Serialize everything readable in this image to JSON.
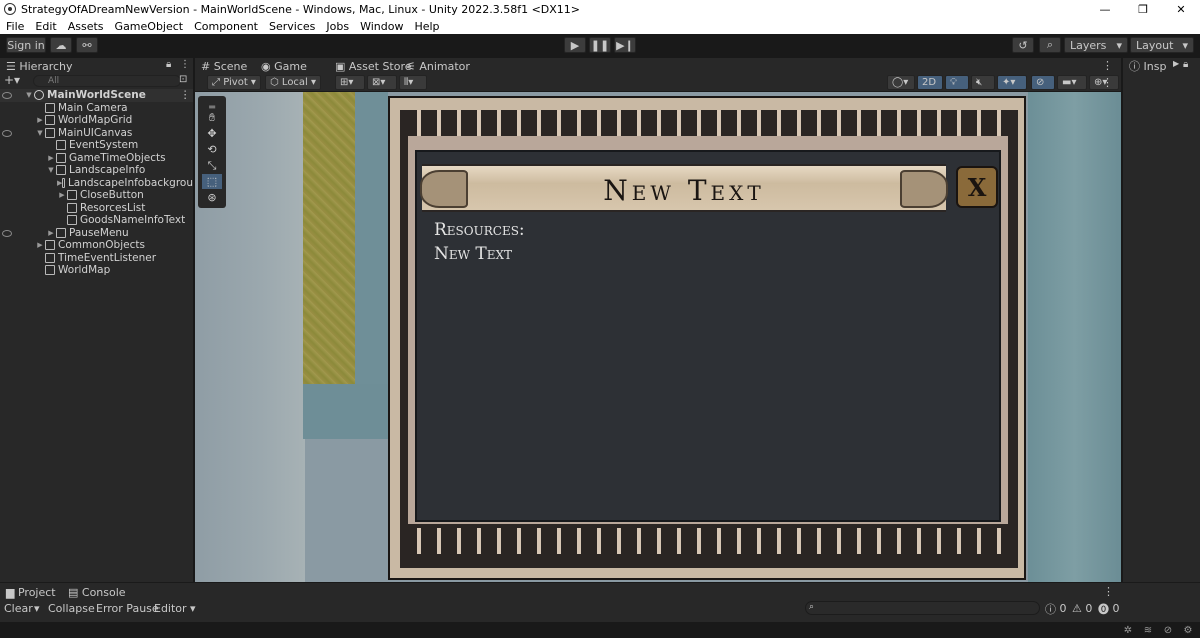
{
  "window": {
    "title": "StrategyOfADreamNewVersion - MainWorldScene - Windows, Mac, Linux - Unity 2022.3.58f1 <DX11>"
  },
  "menu": [
    "File",
    "Edit",
    "Assets",
    "GameObject",
    "Component",
    "Services",
    "Jobs",
    "Window",
    "Help"
  ],
  "toolbar": {
    "sign_in": "Sign in",
    "layers": "Layers",
    "layout": "Layout"
  },
  "hierarchy": {
    "tab": "Hierarchy",
    "search_placeholder": "All",
    "rows": [
      {
        "label": "MainWorldScene",
        "depth": 0,
        "arrow": "▼",
        "scene": true
      },
      {
        "label": "Main Camera",
        "depth": 1,
        "arrow": ""
      },
      {
        "label": "WorldMapGrid",
        "depth": 1,
        "arrow": "▶"
      },
      {
        "label": "MainUICanvas",
        "depth": 1,
        "arrow": "▼"
      },
      {
        "label": "EventSystem",
        "depth": 2,
        "arrow": ""
      },
      {
        "label": "GameTimeObjects",
        "depth": 2,
        "arrow": "▶"
      },
      {
        "label": "LandscapeInfo",
        "depth": 2,
        "arrow": "▼"
      },
      {
        "label": "LandscapeInfobackgrou",
        "depth": 3,
        "arrow": "▶"
      },
      {
        "label": "CloseButton",
        "depth": 3,
        "arrow": "▶"
      },
      {
        "label": "ResorcesList",
        "depth": 3,
        "arrow": ""
      },
      {
        "label": "GoodsNameInfoText",
        "depth": 3,
        "arrow": ""
      },
      {
        "label": "PauseMenu",
        "depth": 2,
        "arrow": "▶"
      },
      {
        "label": "CommonObjects",
        "depth": 1,
        "arrow": "▶"
      },
      {
        "label": "TimeEventListener",
        "depth": 1,
        "arrow": ""
      },
      {
        "label": "WorldMap",
        "depth": 1,
        "arrow": ""
      }
    ]
  },
  "scene_tabs": {
    "scene": "Scene",
    "game": "Game",
    "asset_store": "Asset Store",
    "animator": "Animator"
  },
  "scene_toolbar": {
    "pivot": "Pivot",
    "local": "Local",
    "mode_2d": "2D"
  },
  "ui_panel": {
    "title": "New Text",
    "resources_label": "Resources:",
    "resources_text": "New Text"
  },
  "inspector": {
    "tab": "Insp"
  },
  "console": {
    "project_tab": "Project",
    "console_tab": "Console",
    "clear": "Clear",
    "collapse": "Collapse",
    "error_pause": "Error Pause",
    "editor": "Editor",
    "info_count": "0",
    "warn_count": "0",
    "error_count": "0"
  }
}
